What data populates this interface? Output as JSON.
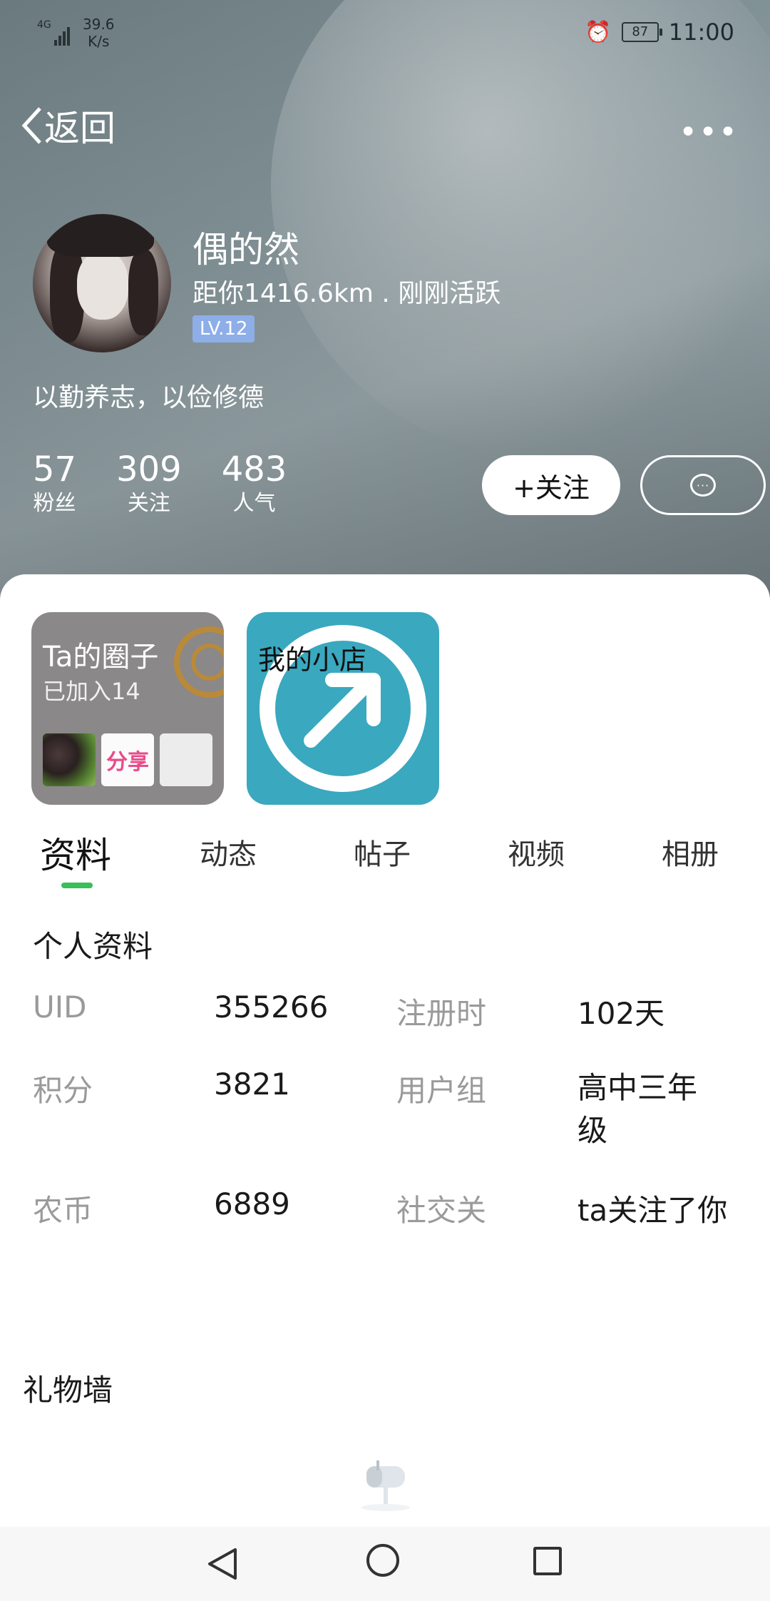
{
  "status": {
    "network": "4G",
    "speed_value": "39.6",
    "speed_unit": "K/s",
    "battery": "87",
    "time": "11:00"
  },
  "topbar": {
    "back_label": "返回",
    "more": "•••"
  },
  "profile": {
    "name": "偶的然",
    "distance": "距你1416.6km . 刚刚活跃",
    "level": "LV.12",
    "bio": "以勤养志，以俭修德"
  },
  "stats": [
    {
      "num": "57",
      "label": "粉丝"
    },
    {
      "num": "309",
      "label": "关注"
    },
    {
      "num": "483",
      "label": "人气"
    }
  ],
  "actions": {
    "follow": "+关注"
  },
  "cards": {
    "circle": {
      "title": "Ta的圈子",
      "sub": "已加入14",
      "thumb2": "分享"
    },
    "shop": {
      "title": "我的小店"
    }
  },
  "tabs": [
    "资料",
    "动态",
    "帖子",
    "视频",
    "相册"
  ],
  "info": {
    "title": "个人资料",
    "rows": [
      {
        "l1": "UID",
        "v1": "355266",
        "l2": "注册时",
        "v2": "102天"
      },
      {
        "l1": "积分",
        "v1": "3821",
        "l2": "用户组",
        "v2": "高中三年级"
      },
      {
        "l1": "农币",
        "v1": "6889",
        "l2": "社交关",
        "v2": "ta关注了你"
      }
    ]
  },
  "gift": {
    "title": "礼物墙"
  },
  "colors": {
    "accent_green": "#37c05a",
    "level_badge": "#8eaee8",
    "shop_blue": "#3aa8bf"
  }
}
